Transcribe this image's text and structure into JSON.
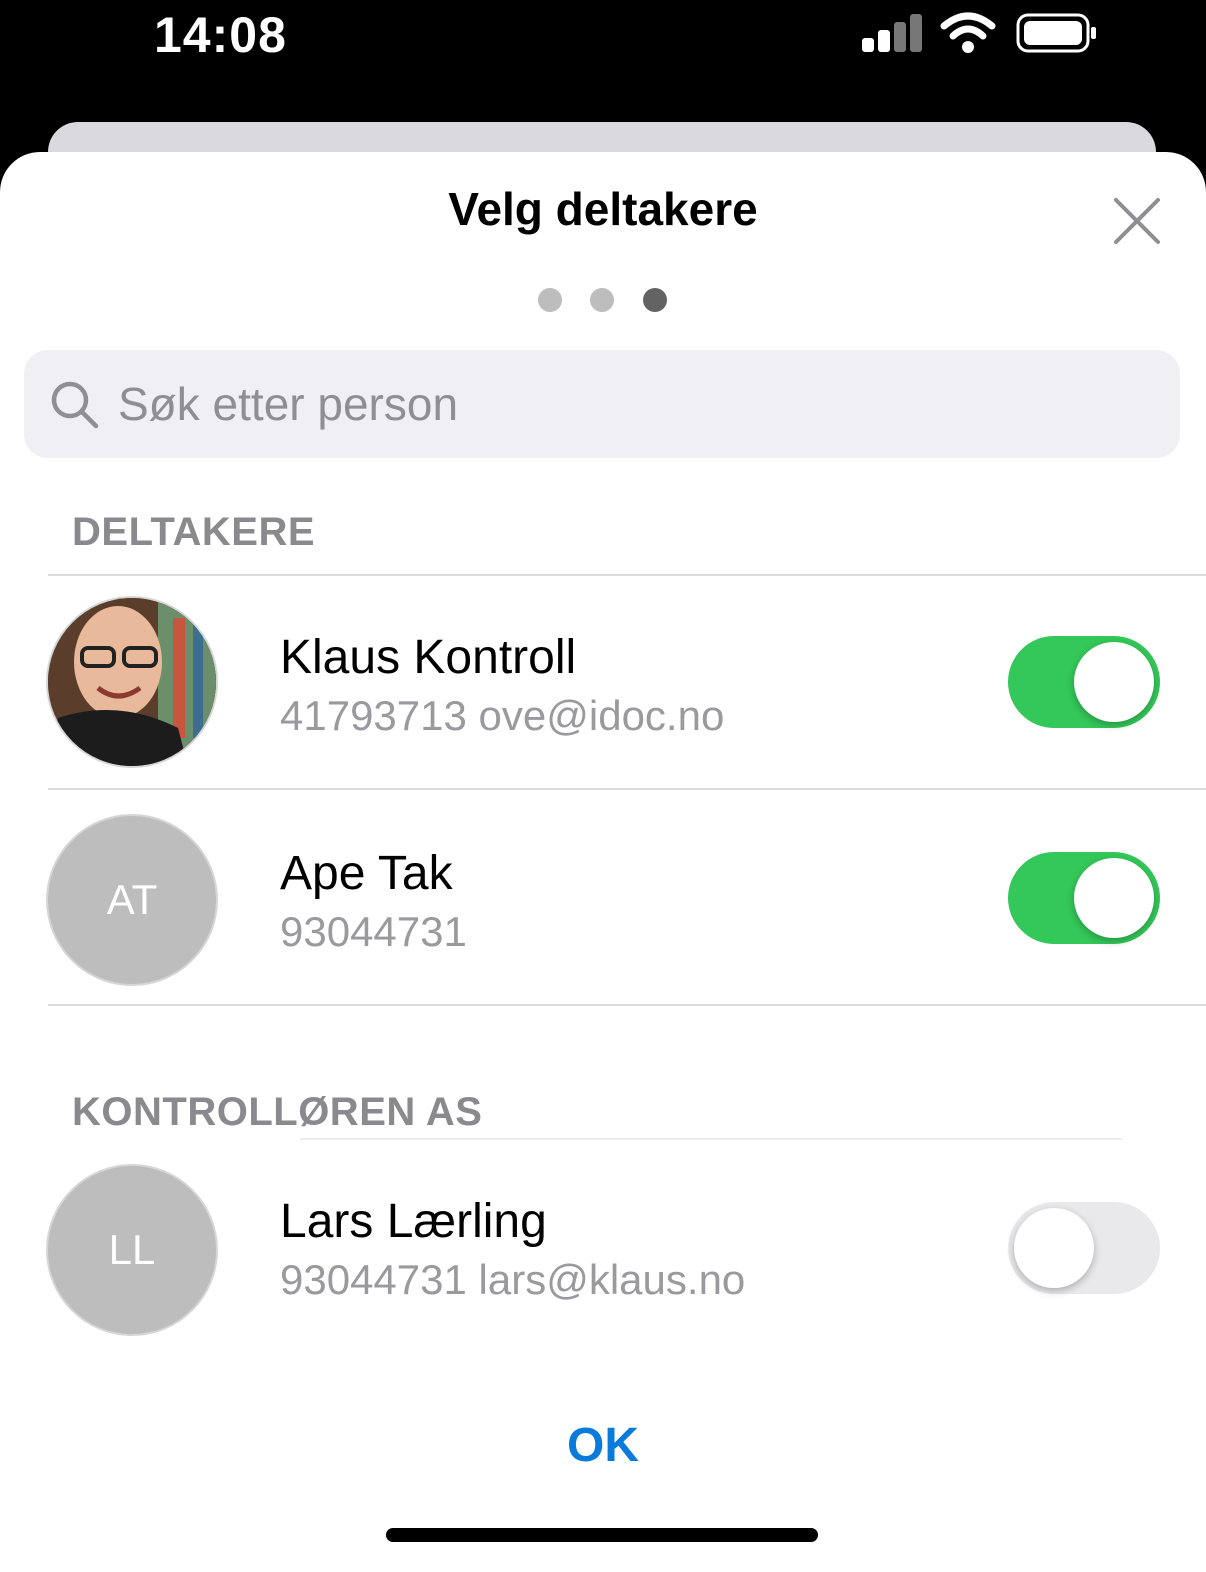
{
  "status_bar": {
    "time": "14:08"
  },
  "sheet": {
    "title": "Velg deltakere",
    "step_indicator": {
      "total": 3,
      "current": 3
    }
  },
  "search": {
    "placeholder": "Søk etter person",
    "value": ""
  },
  "sections": [
    {
      "header": "DELTAKERE",
      "people": [
        {
          "name": "Klaus Kontroll",
          "detail": "41793713 ove@idoc.no",
          "avatar": "photo",
          "selected": true
        },
        {
          "name": "Ape Tak",
          "detail": "93044731",
          "initials": "AT",
          "selected": true
        }
      ]
    },
    {
      "header": "KONTROLLØREN AS",
      "people": [
        {
          "name": "Lars Lærling",
          "detail": "93044731 lars@klaus.no",
          "initials": "LL",
          "selected": false
        }
      ]
    }
  ],
  "ok_label": "OK",
  "colors": {
    "accent": "#0a7bdb",
    "toggle_on": "#34c759",
    "toggle_off": "#e9e9eb"
  }
}
